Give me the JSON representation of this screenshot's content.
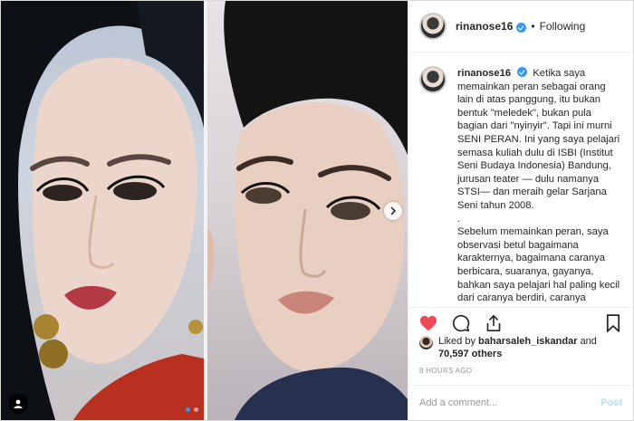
{
  "post": {
    "username": "rinanose16",
    "separator": "•",
    "follow_status": "Following",
    "caption_user": "rinanose16",
    "caption_paragraphs": [
      "Ketika saya memainkan peran sebagai orang lain di atas panggung, itu bukan bentuk \"meledek\", bukan pula bagian dari \"nyinyir\". Tapi ini murni SENI PERAN. Ini yang saya pelajari semasa kuliah dulu di ISBI (Institut Seni Budaya Indonesia) Bandung, jurusan teater — dulu namanya STSI— dan meraih gelar Sarjana Seni tahun 2008.",
      ".",
      "Sebelum memainkan peran, saya observasi betul bagaimana karakternya, bagaimana caranya berbicara, suaranya, gayanya, bahkan saya pelajari hal paling kecil dari caranya berdiri, caranya menatap, bentuk detil wajah, ekspresi dan bahkan makeupnya, sampai"
    ],
    "likes_prefix": "Liked by",
    "liked_by_user": "baharsaleh_iskandar",
    "likes_conj": "and",
    "likes_count": "70,597 others",
    "timestamp": "8 HOURS AGO",
    "comment_placeholder": "Add a comment...",
    "post_button": "Post"
  },
  "carousel": {
    "total": 2,
    "active_index": 0
  },
  "colors": {
    "accent": "#3897f0",
    "like_red": "#ed4956",
    "post_disabled": "#b2dffc"
  },
  "icons": [
    "verified-badge-icon",
    "heart-icon",
    "comment-icon",
    "share-icon",
    "bookmark-icon",
    "chevron-right-icon",
    "user-tag-icon"
  ]
}
